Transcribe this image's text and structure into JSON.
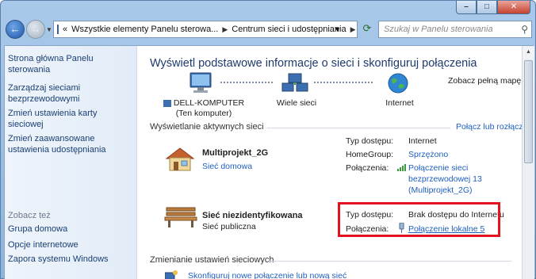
{
  "window": {
    "caption": {
      "minimize": "–",
      "maximize": "□",
      "close": "✕"
    }
  },
  "toolbar": {
    "breadcrumb": [
      "Wszystkie elementy Panelu sterowa...",
      "Centrum sieci i udostępniania"
    ],
    "breadcrumb_prefix": "«",
    "search_placeholder": "Szukaj w Panelu sterowania"
  },
  "sidebar": {
    "items": [
      {
        "label": "Strona główna Panelu sterowania"
      },
      {
        "label": "Zarządzaj sieciami bezprzewodowymi"
      },
      {
        "label": "Zmień ustawienia karty sieciowej"
      },
      {
        "label": "Zmień zaawansowane ustawienia udostępniania"
      }
    ],
    "see_also_title": "Zobacz też",
    "see_also": [
      {
        "label": "Grupa domowa"
      },
      {
        "label": "Opcje internetowe"
      },
      {
        "label": "Zapora systemu Windows"
      }
    ]
  },
  "main": {
    "title": "Wyświetl podstawowe informacje o sieci i skonfiguruj połączenia",
    "full_map_link": "Zobacz pełną mapę",
    "map": {
      "computer": "DELL-KOMPUTER",
      "computer_sub": "(Ten komputer)",
      "middle": "Wiele sieci",
      "internet": "Internet"
    },
    "active_header": "Wyświetlanie aktywnych sieci",
    "connect_link": "Połącz lub rozłącz",
    "networks": [
      {
        "name": "Multiprojekt_2G",
        "type_link": "Sieć domowa",
        "access_label": "Typ dostępu:",
        "access_value": "Internet",
        "homegroup_label": "HomeGroup:",
        "homegroup_value": "Sprzężono",
        "conn_label": "Połączenia:",
        "conn_value": [
          "Połączenie sieci",
          "bezprzewodowej 13",
          "(Multiprojekt_2G)"
        ]
      },
      {
        "name": "Sieć niezidentyfikowana",
        "type_text": "Sieć publiczna",
        "access_label": "Typ dostępu:",
        "access_value": "Brak dostępu do Internetu",
        "conn_label": "Połączenia:",
        "conn_value": "Połączenie lokalne 5"
      }
    ],
    "change_header": "Zmienianie ustawień sieciowych",
    "setup_link": "Skonfiguruj nowe połączenie lub nową sieć"
  }
}
